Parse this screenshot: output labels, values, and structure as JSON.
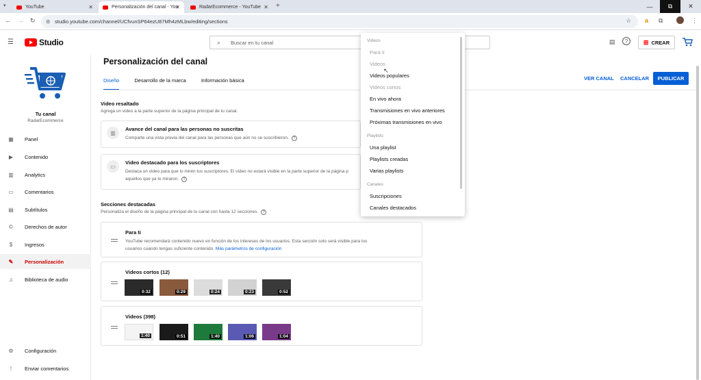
{
  "browser": {
    "tabs": [
      {
        "label": "YouTube"
      },
      {
        "label": "Personalización del canal - You"
      },
      {
        "label": "RadarEcommerce - YouTube"
      }
    ],
    "new_tab": "+",
    "url": "studio.youtube.com/channel/UCfvunSP64ezU87Mh4zMLbw/editing/sections"
  },
  "header": {
    "logo_text": "Studio",
    "search_placeholder": "Buscar en tu canal",
    "create_label": "CREAR"
  },
  "sidebar": {
    "channel_title": "Tu canal",
    "channel_name": "RadarEcommerce",
    "items": [
      {
        "label": "Panel",
        "icon": "grid-icon"
      },
      {
        "label": "Contenido",
        "icon": "video-icon"
      },
      {
        "label": "Analytics",
        "icon": "chart-icon"
      },
      {
        "label": "Comentarios",
        "icon": "comment-icon"
      },
      {
        "label": "Subtítulos",
        "icon": "subtitles-icon"
      },
      {
        "label": "Derechos de autor",
        "icon": "copyright-icon"
      },
      {
        "label": "Ingresos",
        "icon": "dollar-icon"
      },
      {
        "label": "Personalización",
        "icon": "wand-icon",
        "active": true
      },
      {
        "label": "Biblioteca de audio",
        "icon": "audio-library-icon"
      }
    ],
    "bottom": [
      {
        "label": "Configuración",
        "icon": "gear-icon"
      },
      {
        "label": "Enviar comentarios",
        "icon": "feedback-icon"
      }
    ]
  },
  "main": {
    "title": "Personalización del canal",
    "tabs": [
      {
        "label": "Diseño",
        "active": true
      },
      {
        "label": "Desarrollo de la marca"
      },
      {
        "label": "Información básica"
      }
    ],
    "actions": {
      "view": "VER CANAL",
      "cancel": "CANCELAR",
      "publish": "PUBLICAR"
    },
    "featured": {
      "title": "Video resaltado",
      "subtitle": "Agrega un video a la parte superior de la página principal de tu canal.",
      "cards": [
        {
          "title": "Avance del canal para las personas no suscritas",
          "desc": "Comparte una vista previa del canal para las personas que aún no se suscribieron."
        },
        {
          "title": "Video destacado para los suscriptores",
          "desc": "Destaca un video para que lo miren tus suscriptores. El video no estará visible en la parte superior de la página p",
          "desc2": "aquellos que ya lo miraron."
        }
      ]
    },
    "sections": {
      "title": "Secciones destacadas",
      "subtitle": "Personaliza el diseño de la página principal de tu canal con hasta 12 secciones.",
      "para_ti": {
        "title": "Para ti",
        "desc1": "YouTube recomendará contenido nuevo en función de los intereses de los usuarios. Esta sección solo será visible para los",
        "desc2": "usuarios cuando tengas suficiente contenido.",
        "link": "Más parámetros de configuración"
      },
      "shorts": {
        "title": "Videos cortos (12)",
        "durations": [
          "0:32",
          "0:29",
          "0:24",
          "0:23",
          "0:52"
        ]
      },
      "videos": {
        "title": "Videos (398)",
        "durations": [
          "1:40",
          "0:51",
          "1:40",
          "1:06",
          "1:04"
        ]
      }
    }
  },
  "dropdown": {
    "groups": [
      {
        "header": "Videos",
        "items": [
          {
            "label": "Para ti",
            "disabled": true
          },
          {
            "label": "Videos",
            "disabled": true
          },
          {
            "label": "Videos populares"
          },
          {
            "label": "Videos cortos",
            "disabled": true
          },
          {
            "label": "En vivo ahora"
          },
          {
            "label": "Transmisiones en vivo anteriores"
          },
          {
            "label": "Próximas transmisiones en vivo"
          }
        ]
      },
      {
        "header": "Playlists",
        "items": [
          {
            "label": "Una playlist"
          },
          {
            "label": "Playlists creadas"
          },
          {
            "label": "Varias playlists"
          }
        ]
      },
      {
        "header": "Canales",
        "items": [
          {
            "label": "Suscripciones"
          },
          {
            "label": "Canales destacados"
          }
        ]
      }
    ]
  },
  "colors": {
    "accent": "#065fd4",
    "brand_red": "#ff0000",
    "active_red": "#cc0000"
  }
}
